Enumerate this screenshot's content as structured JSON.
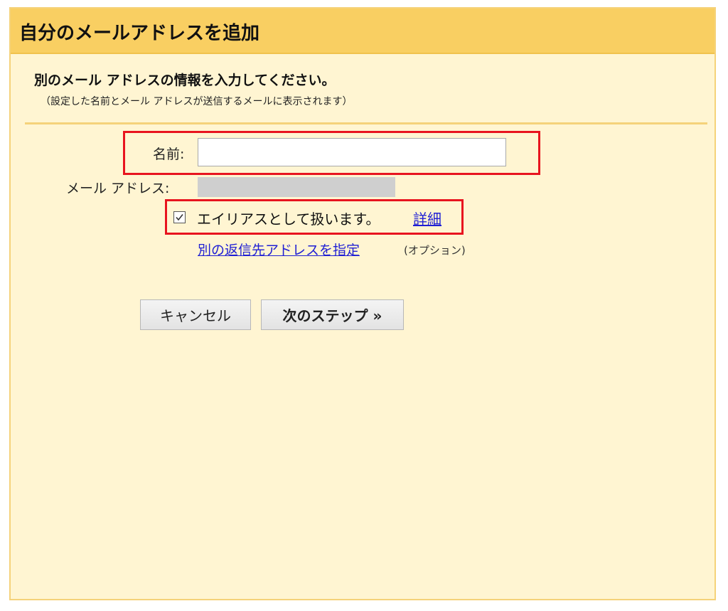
{
  "dialog": {
    "title": "自分のメールアドレスを追加",
    "heading": "別のメール アドレスの情報を入力してください。",
    "subnote": "（設定した名前とメール アドレスが送信するメールに表示されます）"
  },
  "form": {
    "name_label": "名前:",
    "name_value": "",
    "email_label": "メール アドレス:",
    "alias_checked": true,
    "alias_label": "エイリアスとして扱います。",
    "alias_details_link": "詳細",
    "reply_to_link": "別の返信先アドレスを指定",
    "reply_to_optional": "(オプション)"
  },
  "buttons": {
    "cancel": "キャンセル",
    "next": "次のステップ »"
  },
  "colors": {
    "title_bar": "#f9cf62",
    "panel_bg": "#fff5d2",
    "highlight": "#e8141f",
    "link": "#1f1fd4"
  }
}
